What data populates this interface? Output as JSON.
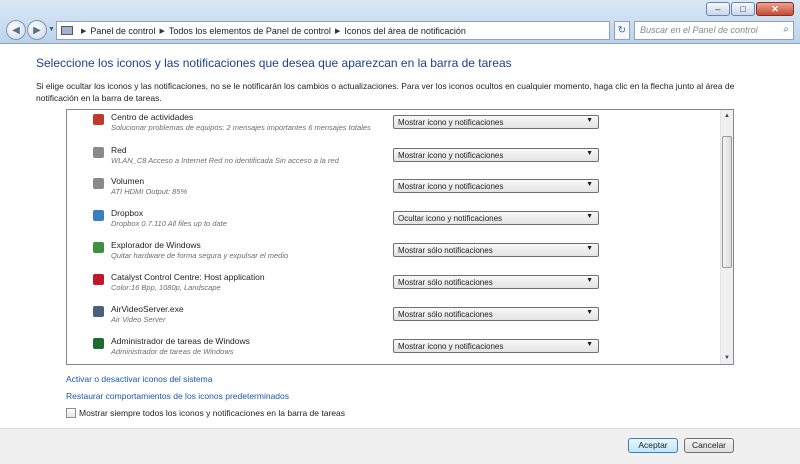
{
  "window": {
    "minimize": "–",
    "maximize": "□",
    "close": "✕"
  },
  "address": {
    "segments": [
      "Panel de control",
      "Todos los elementos de Panel de control",
      "Iconos del área de notificación"
    ]
  },
  "search": {
    "placeholder": "Buscar en el Panel de control"
  },
  "page": {
    "title": "Seleccione los iconos y las notificaciones que desea que aparezcan en la barra de tareas",
    "description": "Si elige ocultar los iconos y las notificaciones, no se le notificarán los cambios o actualizaciones. Para ver los iconos ocultos en cualquier momento, haga clic en la flecha junto al área de notificación en la barra de tareas."
  },
  "items": [
    {
      "name": "Centro de actividades",
      "sub": "Solucionar problemas de equipos: 2 mensajes importantes  6 mensajes totales",
      "behavior": "Mostrar icono y notificaciones",
      "icon": "flag-icon",
      "color": "#c0392b"
    },
    {
      "name": "Red",
      "sub": "WLAN_C8 Acceso a Internet Red no identificada Sin acceso a la red",
      "behavior": "Mostrar icono y notificaciones",
      "icon": "network-icon",
      "color": "#8a8a8a"
    },
    {
      "name": "Volumen",
      "sub": "ATI HDMI Output: 85%",
      "behavior": "Mostrar icono y notificaciones",
      "icon": "speaker-icon",
      "color": "#8a8a8a"
    },
    {
      "name": "Dropbox",
      "sub": "Dropbox 0.7.110 All files up to date",
      "behavior": "Ocultar icono y notificaciones",
      "icon": "dropbox-icon",
      "color": "#3a7fc2"
    },
    {
      "name": "Explorador de Windows",
      "sub": "Quitar hardware de forma segura y expulsar el medio",
      "behavior": "Mostrar sólo notificaciones",
      "icon": "usb-icon",
      "color": "#3f8f3f"
    },
    {
      "name": "Catalyst Control Centre: Host application",
      "sub": "Color:16 Bpp, 1080p, Landscape",
      "behavior": "Mostrar sólo notificaciones",
      "icon": "ati-icon",
      "color": "#c0182a"
    },
    {
      "name": "AirVideoServer.exe",
      "sub": "Air Video Server",
      "behavior": "Mostrar sólo notificaciones",
      "icon": "app-window-icon",
      "color": "#4a5f7a"
    },
    {
      "name": "Administrador de tareas de Windows",
      "sub": "Administrador de tareas de Windows",
      "behavior": "Mostrar icono y notificaciones",
      "icon": "task-manager-icon",
      "color": "#1d6b2e"
    }
  ],
  "links": {
    "system_icons": "Activar o desactivar iconos del sistema",
    "restore": "Restaurar comportamientos de los iconos predeterminados"
  },
  "always_show": {
    "label": "Mostrar siempre todos los iconos y notificaciones en la barra de tareas",
    "checked": false
  },
  "buttons": {
    "accept": "Aceptar",
    "cancel": "Cancelar"
  }
}
